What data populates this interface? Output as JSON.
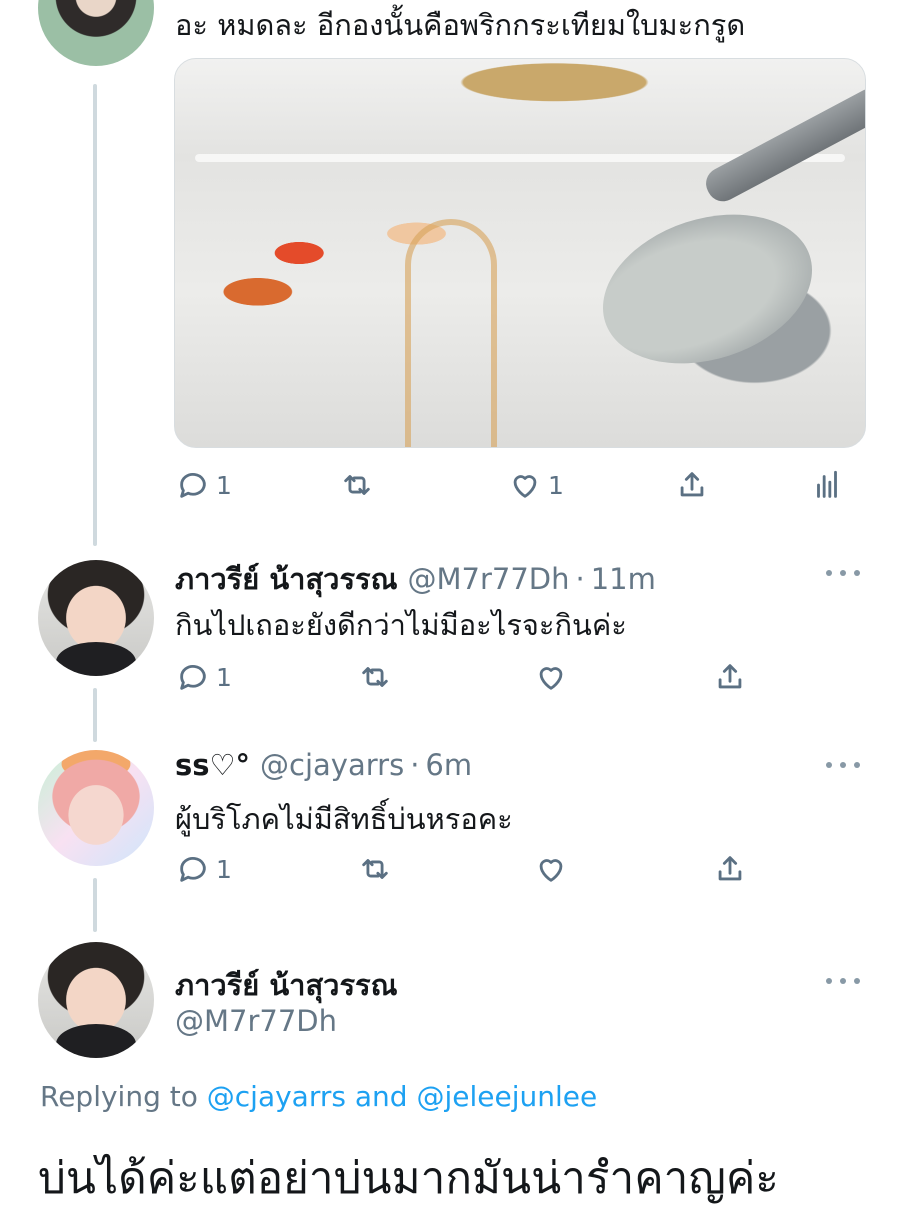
{
  "tweet_main": {
    "text": "อะ หมดละ อีกองนั้นคือพริกกระเทียมใบมะกรูด",
    "reply_count": "1",
    "like_count": "1"
  },
  "reply1": {
    "name": "ภาวรีย์ น้าสุวรรณ",
    "handle": "@M7r77Dh",
    "sep": "·",
    "time": "11m",
    "text": "กินไปเถอะยังดีกว่าไม่มีอะไรจะกินค่ะ",
    "reply_count": "1"
  },
  "reply2": {
    "name": "ss♡°",
    "handle": "@cjayarrs",
    "sep": "·",
    "time": "6m",
    "text": "ผู้บริโภคไม่มีสิทธิ์บ่นหรอคะ",
    "reply_count": "1"
  },
  "focus": {
    "name": "ภาวรีย์ น้าสุวรรณ",
    "handle": "@M7r77Dh",
    "replying_to": "Replying to",
    "mention1": "@cjayarrs",
    "and": "and",
    "mention2": "@jeleejunlee",
    "text": "บ่นได้ค่ะแต่อย่าบ่นมากมันน่ารำคาญค่ะ"
  },
  "icons": [
    "reply-icon",
    "retweet-icon",
    "like-icon",
    "share-icon",
    "analytics-icon",
    "more-icon"
  ],
  "colors": {
    "link": "#1da1f2",
    "muted": "#657786",
    "thread_line": "#cfd9de"
  }
}
